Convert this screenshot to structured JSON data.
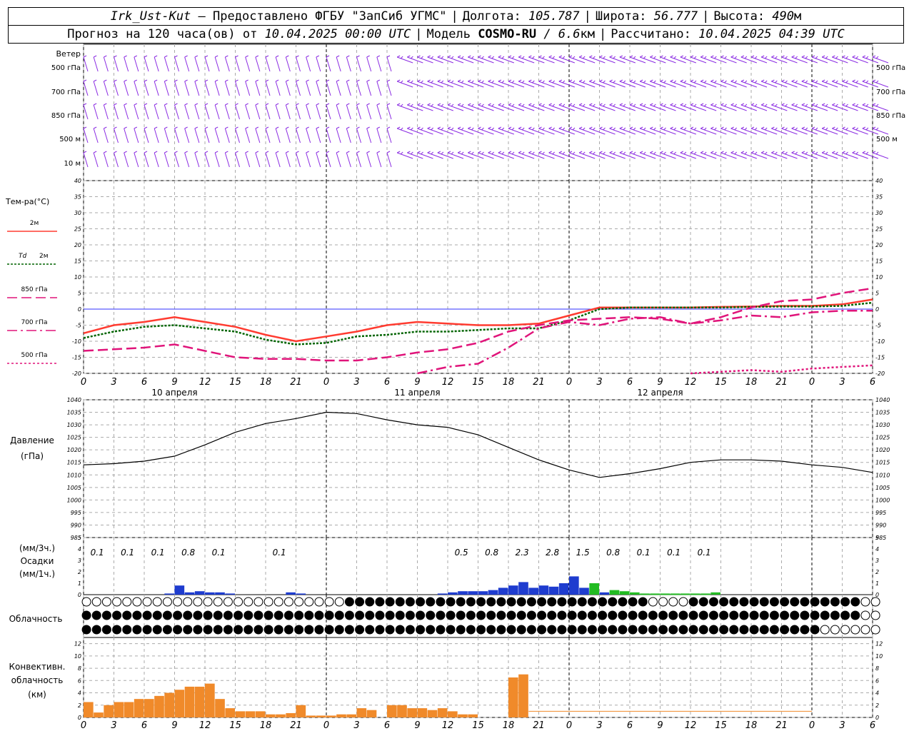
{
  "header": {
    "station": "Irk_Ust-Kut",
    "provider": "– Предоставлено ФГБУ \"ЗапСиб УГМС\"",
    "lon_label": "Долгота:",
    "lon_value": "105.787",
    "lat_label": "Широта:",
    "lat_value": "56.777",
    "alt_label": "Высота:",
    "alt_value": "490",
    "alt_unit": "м",
    "forecast_label": "Прогноз на 120 часа(ов) от",
    "forecast_start": "10.04.2025 00:00 UTC",
    "model_label": "Модель",
    "model_name": "COSMO-RU",
    "model_res": "/ 6.6",
    "model_res_unit": "км",
    "calc_label": "Рассчитано:",
    "calc_time": "10.04.2025 04:39 UTC"
  },
  "colors": {
    "wind": "#8a2be2",
    "t2m": "#ff3b30",
    "td2m": "#006400",
    "t850": "#e0147a",
    "t700": "#e0147a",
    "t500": "#e0147a",
    "zero_line": "#3030ff",
    "precip_rain": "#1e3ccf",
    "precip_mix": "#22bb22",
    "convective": "#f08a2a",
    "grid": "#aaaaaa"
  },
  "time_axis": {
    "tick_labels": [
      "0",
      "3",
      "6",
      "9",
      "12",
      "15",
      "18",
      "21",
      "0",
      "3",
      "6",
      "9",
      "12",
      "15",
      "18",
      "21",
      "0",
      "3",
      "6",
      "9",
      "12",
      "15",
      "18",
      "21",
      "0",
      "3",
      "6"
    ],
    "day_labels": [
      "10 апреля",
      "11 апреля",
      "12 апреля"
    ]
  },
  "chart_data": [
    {
      "type": "wind_barbs",
      "title": "Ветер",
      "levels": [
        "500 гПа",
        "700 гПа",
        "850 гПа",
        "500 м",
        "10  м"
      ]
    },
    {
      "type": "line",
      "title": "Тем-ра(°С)",
      "x_hours": [
        0,
        3,
        6,
        9,
        12,
        15,
        18,
        21,
        24,
        27,
        30,
        33,
        36,
        39,
        42,
        45,
        48,
        51,
        54,
        57,
        60,
        63,
        66,
        69,
        72,
        75,
        78
      ],
      "ylim": [
        -20,
        40
      ],
      "yticks": [
        "-20",
        "-15",
        "-10",
        "-5",
        "0",
        "5",
        "10",
        "15",
        "20",
        "25",
        "30",
        "35",
        "40"
      ],
      "series": [
        {
          "name": "2м",
          "legend": "2м",
          "values": [
            -7.5,
            -5,
            -4,
            -2.5,
            -4,
            -5.5,
            -8,
            -10,
            -8.5,
            -7,
            -5,
            -4,
            -4.5,
            -5,
            -5,
            -4.5,
            -2,
            0.5,
            0.5,
            0.5,
            0.5,
            0.7,
            0.8,
            1,
            1,
            1.5,
            3
          ]
        },
        {
          "name": "Td 2м",
          "legend_symbol": "Td",
          "legend": "2м",
          "values": [
            -9,
            -7,
            -5.5,
            -5,
            -6,
            -7,
            -9.5,
            -11,
            -10.5,
            -8.5,
            -8,
            -7,
            -7,
            -6.5,
            -6,
            -6,
            -3.5,
            0,
            0.5,
            0.5,
            0.5,
            0.5,
            0.7,
            0.8,
            0.8,
            1,
            2
          ]
        },
        {
          "name": "850 гПа",
          "legend": "850 гПа",
          "values": [
            -13,
            -12.5,
            -12,
            -11,
            -13,
            -15,
            -15.5,
            -15.5,
            -16,
            -16,
            -15,
            -13.5,
            -12.5,
            -10.5,
            -7,
            -5,
            -3.5,
            -3,
            -2.5,
            -3,
            -4.5,
            -2.5,
            0.5,
            2.5,
            3,
            5,
            6.5
          ]
        },
        {
          "name": "700 гПа",
          "legend": "700 гПа",
          "values": [
            null,
            null,
            null,
            null,
            null,
            null,
            null,
            null,
            null,
            null,
            null,
            -21,
            -18,
            -17,
            -12,
            -6,
            -4,
            -5,
            -3,
            -2.5,
            -4.5,
            -3.5,
            -2,
            -2.5,
            -1,
            -0.5,
            -0.5
          ]
        },
        {
          "name": "500 гПа",
          "legend": "500 гПа",
          "values": [
            null,
            null,
            null,
            null,
            null,
            null,
            null,
            null,
            null,
            null,
            null,
            null,
            null,
            null,
            null,
            null,
            null,
            null,
            null,
            null,
            -20,
            -19.5,
            -19,
            -19.5,
            -18.5,
            -18,
            -17.5
          ]
        }
      ]
    },
    {
      "type": "line",
      "title": "Давление",
      "unit": "(гПа)",
      "ylim": [
        985,
        1040
      ],
      "yticks": [
        "985",
        "990",
        "995",
        "1000",
        "1005",
        "1010",
        "1015",
        "1020",
        "1025",
        "1030",
        "1035",
        "1040"
      ],
      "x_hours": [
        0,
        3,
        6,
        9,
        12,
        15,
        18,
        21,
        24,
        27,
        30,
        33,
        36,
        39,
        42,
        45,
        48,
        51,
        54,
        57,
        60,
        63,
        66,
        69,
        72,
        75,
        78
      ],
      "series": [
        {
          "name": "Давление",
          "values": [
            1014,
            1014.5,
            1015.5,
            1017.5,
            1022,
            1027,
            1030.5,
            1032.5,
            1035,
            1034.5,
            1032,
            1030,
            1029,
            1026,
            1021,
            1016,
            1012,
            1009,
            1010.5,
            1012.5,
            1015,
            1016,
            1016,
            1015.5,
            1014,
            1013,
            1011
          ]
        }
      ]
    },
    {
      "type": "bar",
      "title": "Осадки",
      "unit_3h": "(мм/3ч.)",
      "unit_1h": "(мм/1ч.)",
      "ylim": [
        0,
        5
      ],
      "yticks": [
        "0",
        "1",
        "2",
        "3",
        "4",
        "5"
      ],
      "totals_3h": [
        {
          "h": 1,
          "v": "0.1"
        },
        {
          "h": 4,
          "v": "0.1"
        },
        {
          "h": 7,
          "v": "0.1"
        },
        {
          "h": 10,
          "v": "0.8"
        },
        {
          "h": 13,
          "v": "0.1"
        },
        {
          "h": 19,
          "v": "0.1"
        },
        {
          "h": 37,
          "v": "0.5"
        },
        {
          "h": 40,
          "v": "0.8"
        },
        {
          "h": 43,
          "v": "2.3"
        },
        {
          "h": 46,
          "v": "2.8"
        },
        {
          "h": 49,
          "v": "1.5"
        },
        {
          "h": 52,
          "v": "0.8"
        },
        {
          "h": 55,
          "v": "0.1"
        },
        {
          "h": 58,
          "v": "0.1"
        },
        {
          "h": 61,
          "v": "0.1"
        }
      ],
      "hourly_rain": [
        [
          8,
          0.1
        ],
        [
          9,
          0.8
        ],
        [
          10,
          0.2
        ],
        [
          11,
          0.3
        ],
        [
          12,
          0.2
        ],
        [
          13,
          0.2
        ],
        [
          14,
          0.1
        ],
        [
          20,
          0.2
        ],
        [
          21,
          0.1
        ],
        [
          35,
          0.1
        ],
        [
          36,
          0.2
        ],
        [
          37,
          0.3
        ],
        [
          38,
          0.3
        ],
        [
          39,
          0.3
        ],
        [
          40,
          0.4
        ],
        [
          41,
          0.6
        ],
        [
          42,
          0.8
        ],
        [
          43,
          1.1
        ],
        [
          44,
          0.6
        ],
        [
          45,
          0.8
        ],
        [
          46,
          0.7
        ],
        [
          47,
          1.0
        ],
        [
          48,
          1.6
        ],
        [
          49,
          0.6
        ],
        [
          50,
          0.3
        ],
        [
          51,
          0.2
        ],
        [
          52,
          0.1
        ]
      ],
      "hourly_mix": [
        [
          50,
          1.0
        ],
        [
          52,
          0.4
        ],
        [
          53,
          0.3
        ],
        [
          54,
          0.2
        ],
        [
          55,
          0.1
        ],
        [
          56,
          0.1
        ],
        [
          57,
          0.1
        ],
        [
          58,
          0.1
        ],
        [
          59,
          0.1
        ],
        [
          60,
          0.1
        ],
        [
          61,
          0.1
        ],
        [
          62,
          0.2
        ]
      ]
    },
    {
      "type": "cloud_symbols",
      "title": "Облачность",
      "rows": 3,
      "hours": 79
    },
    {
      "type": "bar",
      "title": "Конвективн. облачность",
      "unit": "(км)",
      "ylim": [
        0,
        13
      ],
      "yticks": [
        "0",
        "2",
        "4",
        "6",
        "8",
        "10",
        "12"
      ],
      "bars": [
        [
          0,
          2.5
        ],
        [
          1,
          0.8
        ],
        [
          2,
          2
        ],
        [
          3,
          2.5
        ],
        [
          4,
          2.5
        ],
        [
          5,
          3
        ],
        [
          6,
          3
        ],
        [
          7,
          3.5
        ],
        [
          8,
          4
        ],
        [
          9,
          4.5
        ],
        [
          10,
          5
        ],
        [
          11,
          5
        ],
        [
          12,
          5.5
        ],
        [
          13,
          3
        ],
        [
          14,
          1.5
        ],
        [
          15,
          1
        ],
        [
          16,
          1
        ],
        [
          17,
          1
        ],
        [
          18,
          0.5
        ],
        [
          19,
          0.5
        ],
        [
          20,
          0.7
        ],
        [
          21,
          2
        ],
        [
          22,
          0.3
        ],
        [
          23,
          0.3
        ],
        [
          24,
          0.3
        ],
        [
          25,
          0.5
        ],
        [
          26,
          0.5
        ],
        [
          27,
          1.5
        ],
        [
          28,
          1.2
        ],
        [
          30,
          2
        ],
        [
          31,
          2
        ],
        [
          32,
          1.5
        ],
        [
          33,
          1.5
        ],
        [
          34,
          1.2
        ],
        [
          35,
          1.5
        ],
        [
          36,
          1
        ],
        [
          37,
          0.5
        ],
        [
          38,
          0.5
        ],
        [
          42,
          6.5
        ],
        [
          43,
          7
        ]
      ]
    }
  ]
}
